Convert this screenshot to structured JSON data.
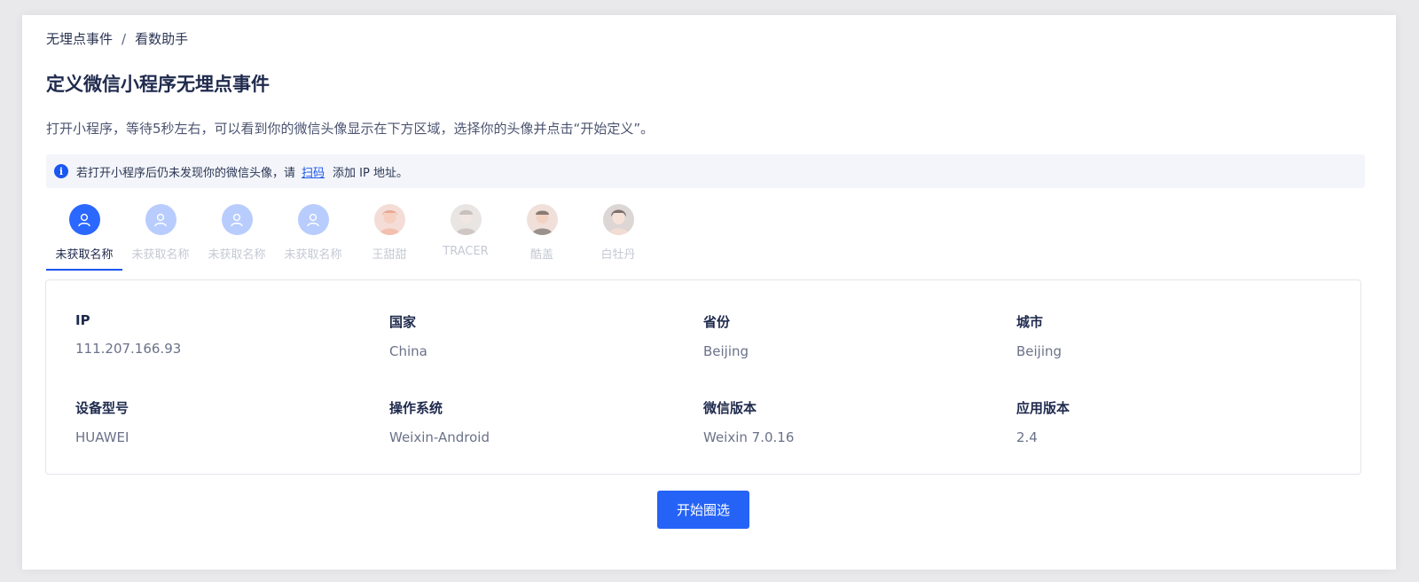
{
  "breadcrumb": {
    "parent": "无埋点事件",
    "separator": "/",
    "current": "看数助手"
  },
  "page_title": "定义微信小程序无埋点事件",
  "subtitle": "打开小程序，等待5秒左右，可以看到你的微信头像显示在下方区域，选择你的头像并点击“开始定义”。",
  "notice": {
    "icon": "info-icon",
    "before": "若打开小程序后仍未发现你的微信头像，请",
    "link": "扫码",
    "after": "添加 IP 地址。"
  },
  "users": [
    {
      "name": "未获取名称",
      "avatar": "default-user-icon",
      "active": true
    },
    {
      "name": "未获取名称",
      "avatar": "default-user-icon",
      "active": false
    },
    {
      "name": "未获取名称",
      "avatar": "default-user-icon",
      "active": false
    },
    {
      "name": "未获取名称",
      "avatar": "default-user-icon",
      "active": false
    },
    {
      "name": "王甜甜",
      "avatar": "user-photo",
      "active": false
    },
    {
      "name": "TRACER",
      "avatar": "user-photo",
      "active": false
    },
    {
      "name": "酷盖",
      "avatar": "user-photo",
      "active": false
    },
    {
      "name": "白牡丹",
      "avatar": "user-photo",
      "active": false
    }
  ],
  "details": {
    "ip": {
      "label": "IP",
      "value": "111.207.166.93"
    },
    "country": {
      "label": "国家",
      "value": "China"
    },
    "province": {
      "label": "省份",
      "value": "Beijing"
    },
    "city": {
      "label": "城市",
      "value": "Beijing"
    },
    "device": {
      "label": "设备型号",
      "value": "HUAWEI"
    },
    "os": {
      "label": "操作系统",
      "value": "Weixin-Android"
    },
    "wechat_version": {
      "label": "微信版本",
      "value": "Weixin 7.0.16"
    },
    "app_version": {
      "label": "应用版本",
      "value": "2.4"
    }
  },
  "start_button": "开始圈选",
  "colors": {
    "primary": "#2563f7",
    "active_tab": "#1a56f0",
    "avatar_default": "#2b68ff",
    "avatar_inactive": "#b8cdfd"
  }
}
